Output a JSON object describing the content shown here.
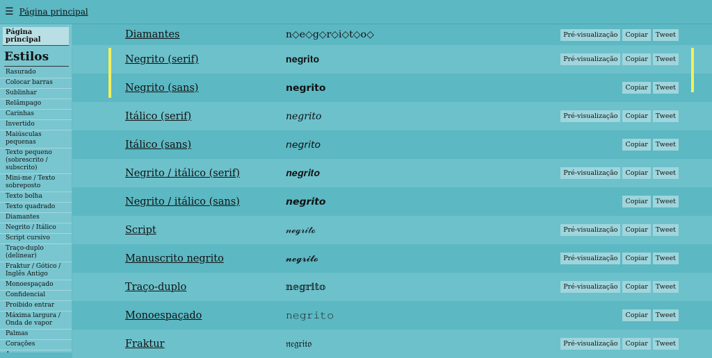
{
  "topbar": {
    "menu_icon": "☰",
    "home_link": "Página principal"
  },
  "sidebar": {
    "home": "Página principal",
    "title": "Estilos",
    "items": [
      "Rasurado",
      "Colocar barras",
      "Sublinhar",
      "Relâmpago",
      "Carinhas",
      "Invertido",
      "Maiúsculas pequenas",
      "Texto pequeno (sobrescrito / subscrito)",
      "Mini-me / Texto sobreposto",
      "Texto bolha",
      "Texto quadrado",
      "Diamantes",
      "Negrito / Itálico",
      "Script cursivo",
      "Traço-duplo (delinear)",
      "Fraktur / Gótico / Inglês Antigo",
      "Monoespaçado",
      "Confidencial",
      "Proibido entrar",
      "Máxima largura / Onda de vapor",
      "Palmas",
      "Corações",
      "Aspas"
    ]
  },
  "buttons": {
    "preview": "Pré-visualização",
    "copy": "Copiar",
    "tweet": "Tweet"
  },
  "rows": [
    {
      "name": "Diamantes",
      "preview": "n◇e◇g◇r◇i◇t◇o◇",
      "has_preview": true
    },
    {
      "name": "Negrito (serif)",
      "preview": "𝐧𝐞𝐠𝐫𝐢𝐭𝐨",
      "has_preview": true
    },
    {
      "name": "Negrito (sans)",
      "preview": "𝗻𝗲𝗴𝗿𝗶𝘁𝗼",
      "has_preview": false
    },
    {
      "name": "Itálico (serif)",
      "preview": "𝑛𝑒𝑔𝑟𝑖𝑡𝑜",
      "has_preview": true
    },
    {
      "name": "Itálico (sans)",
      "preview": "𝘯𝘦𝘨𝘳𝘪𝘵𝘰",
      "has_preview": false
    },
    {
      "name": "Negrito / itálico (serif)",
      "preview": "𝒏𝒆𝒈𝒓𝒊𝒕𝒐",
      "has_preview": true
    },
    {
      "name": "Negrito / itálico (sans)",
      "preview": "𝙣𝙚𝙜𝙧𝙞𝙩𝙤",
      "has_preview": false
    },
    {
      "name": "Script",
      "preview": "𝓃ℯℊ𝓇𝒾𝓉ℴ",
      "has_preview": true
    },
    {
      "name": "Manuscrito negrito",
      "preview": "𝓷𝓮𝓰𝓻𝓲𝓽𝓸",
      "has_preview": true
    },
    {
      "name": "Traço-duplo",
      "preview": "𝕟𝕖𝕘𝕣𝕚𝕥𝕠",
      "has_preview": true
    },
    {
      "name": "Monoespaçado",
      "preview": "𝚗𝚎𝚐𝚛𝚒𝚝𝚘",
      "has_preview": false
    },
    {
      "name": "Fraktur",
      "preview": "𝔫𝔢𝔤𝔯𝔦𝔱𝔬",
      "has_preview": true
    }
  ],
  "colors": {
    "highlight": "#f4f05a",
    "background": "#5cb8c3",
    "row_alt": "#6cc1cb",
    "sidebar": "#79c6d0"
  }
}
